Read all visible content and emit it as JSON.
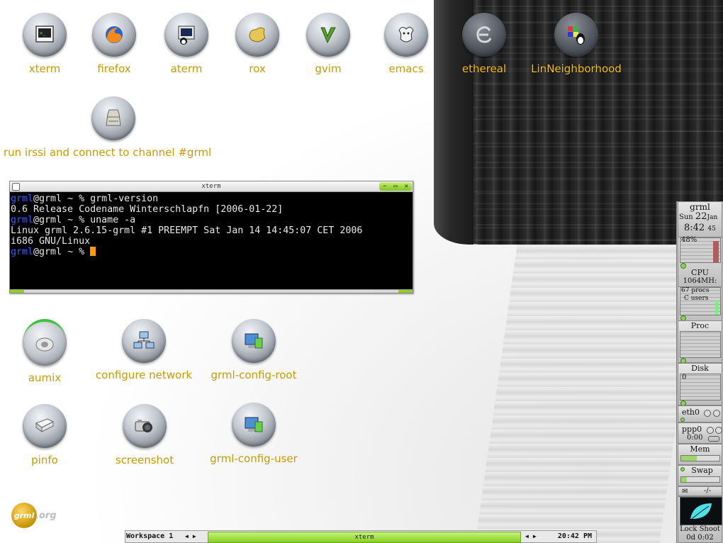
{
  "desktop": {
    "icons": [
      {
        "label": "xterm",
        "icon": "terminal-icon"
      },
      {
        "label": "firefox",
        "icon": "firefox-icon"
      },
      {
        "label": "aterm",
        "icon": "aterm-icon"
      },
      {
        "label": "rox",
        "icon": "rox-icon"
      },
      {
        "label": "gvim",
        "icon": "gvim-icon"
      },
      {
        "label": "emacs",
        "icon": "emacs-icon"
      },
      {
        "label": "ethereal",
        "icon": "ethereal-icon"
      },
      {
        "label": "LinNeighborhood",
        "icon": "linneighborhood-icon"
      },
      {
        "label": "run irssi and connect to channel #grml",
        "icon": "irssi-icon"
      },
      {
        "label": "aumix",
        "icon": "speaker-icon"
      },
      {
        "label": "configure network",
        "icon": "network-icon"
      },
      {
        "label": "grml-config-root",
        "icon": "config-root-icon"
      },
      {
        "label": "pinfo",
        "icon": "book-icon"
      },
      {
        "label": "screenshot",
        "icon": "camera-icon"
      },
      {
        "label": "grml-config-user",
        "icon": "config-user-icon"
      }
    ],
    "logo": {
      "mark": "grml",
      "suffix": ".org"
    }
  },
  "xterm": {
    "title": "xterm",
    "lines": [
      {
        "user": "grml",
        "rest": "@grml ~ % grml-version"
      },
      {
        "user": "",
        "rest": "0.6 Release Codename Winterschlapfn [2006-01-22]"
      },
      {
        "user": "grml",
        "rest": "@grml ~ % uname -a"
      },
      {
        "user": "",
        "rest": "Linux grml 2.6.15-grml #1 PREEMPT Sat Jan 14 14:45:07 CET 2006"
      },
      {
        "user": "",
        "rest": "i686 GNU/Linux"
      },
      {
        "user": "grml",
        "rest": "@grml ~ % "
      }
    ]
  },
  "taskbar": {
    "workspace": "Workspace 1",
    "task": "xterm",
    "clock": "20:42 PM"
  },
  "dock": {
    "host": "grml",
    "day": "Sun",
    "date": "22",
    "month": "Jan",
    "time": "8:42",
    "seconds": "45",
    "cpu_percent": "48%",
    "cpu_label": "CPU",
    "cpu_freq": "1064MH:",
    "procs": "67 procs",
    "users": "C users",
    "proc_label": "Proc",
    "disk_label": "Disk",
    "disk_value": "0",
    "eth_label": "eth0",
    "ppp_label": "ppp0",
    "ppp_time": "0:00",
    "mem_label": "Mem",
    "swap_label": "Swap",
    "mail": "-/-",
    "lock_label": "Lock Shoot",
    "uptime": "0d 0:02"
  }
}
